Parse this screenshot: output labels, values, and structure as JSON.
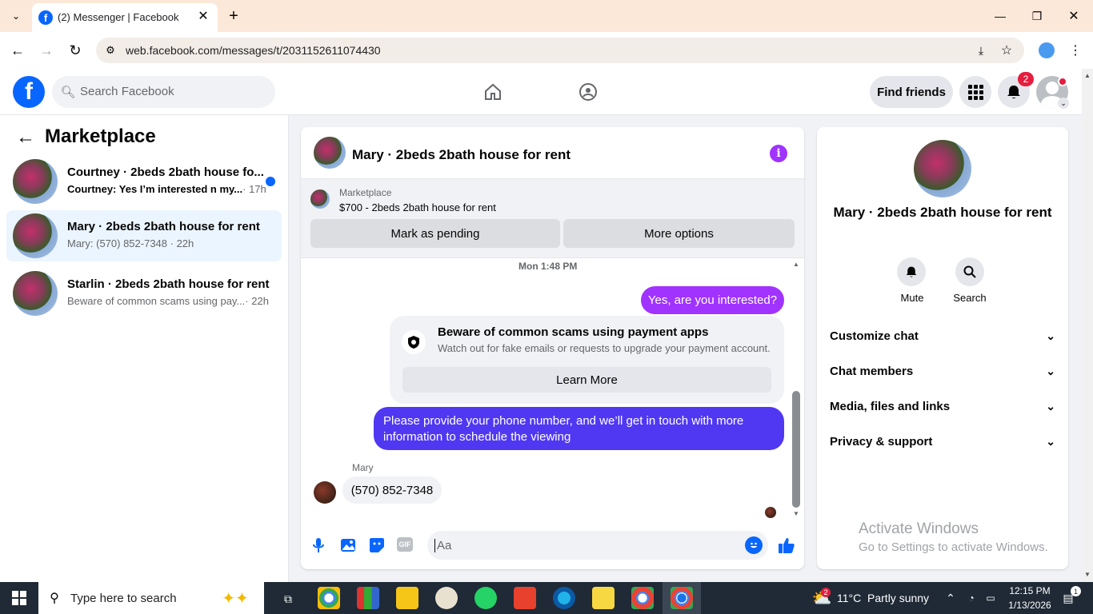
{
  "browser": {
    "tab_title": "(2) Messenger | Facebook",
    "url": "web.facebook.com/messages/t/2031152611074430"
  },
  "fb": {
    "search_placeholder": "Search Facebook",
    "find_friends": "Find friends",
    "notif_count": "2"
  },
  "left": {
    "title": "Marketplace",
    "conversations": [
      {
        "title": "Courtney · 2beds 2bath house fo...",
        "preview": "Courtney: Yes I’m interested n my...",
        "time": "· 17h",
        "unread": true
      },
      {
        "title": "Mary · 2beds 2bath house for rent",
        "preview": "Mary: (570) 852-7348",
        "time": "· 22h",
        "unread": false
      },
      {
        "title": "Starlin · 2beds 2bath house for rent",
        "preview": "Beware of common scams using pay...",
        "time": "· 22h",
        "unread": false
      }
    ]
  },
  "chat": {
    "header_title": "Mary · 2beds 2bath house for rent",
    "listing_source": "Marketplace",
    "listing_title": "$700 - 2beds 2bath house for rent",
    "mark_pending": "Mark as pending",
    "more_options": "More options",
    "timestamp": "Mon 1:48 PM",
    "msg_out_1": "Yes, are you interested?",
    "scam_title": "Beware of common scams using payment apps",
    "scam_body": "Watch out for fake emails or requests to upgrade your payment account.",
    "learn_more": "Learn More",
    "msg_out_2": "Please provide your phone number, and we’ll get in touch with more information to schedule the viewing",
    "sender_name": "Mary",
    "msg_in_1": "(570) 852-7348",
    "composer_placeholder": "Aa"
  },
  "info": {
    "title": "Mary · 2beds 2bath house for rent",
    "mute": "Mute",
    "search": "Search",
    "menu": [
      "Customize chat",
      "Chat members",
      "Media, files and links",
      "Privacy & support"
    ],
    "activate_title": "Activate Windows",
    "activate_body": "Go to Settings to activate Windows."
  },
  "taskbar": {
    "search_placeholder": "Type here to search",
    "weather": "11°C  Partly sunny",
    "time": "12:15 PM",
    "date": "1/13/2026",
    "notif": "1",
    "weather_badge": "2"
  },
  "colors": {
    "fb_blue": "#0866ff",
    "messenger_purple": "#a033ff",
    "out_bubble": "#5038f2"
  }
}
